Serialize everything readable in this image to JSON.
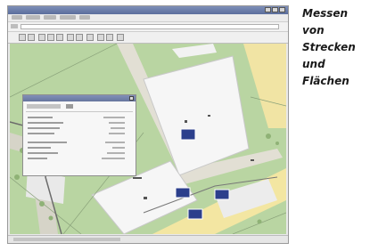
{
  "window": {
    "title": "",
    "colors": {
      "titlebar": "#5b6e9c",
      "chrome": "#e9e9e9",
      "map_green": "#b7d3a0",
      "building": "#f6f6f6",
      "road_yellow": "#f3e6a2",
      "marker_blue": "#2c3f8c"
    }
  },
  "toolbar": {
    "icons": [
      "back-icon",
      "forward-icon",
      "zoom-in-icon",
      "zoom-out-icon",
      "pan-icon",
      "measure-distance-icon",
      "measure-area-icon",
      "print-icon",
      "info-icon",
      "layers-icon",
      "search-icon"
    ]
  },
  "map": {
    "marker_icons": [
      "map-marker-icon",
      "map-marker-icon",
      "map-marker-icon",
      "map-marker-icon"
    ]
  },
  "caption": {
    "lines": [
      "Messen",
      "von",
      "Strecken",
      "und",
      "Flächen"
    ]
  }
}
